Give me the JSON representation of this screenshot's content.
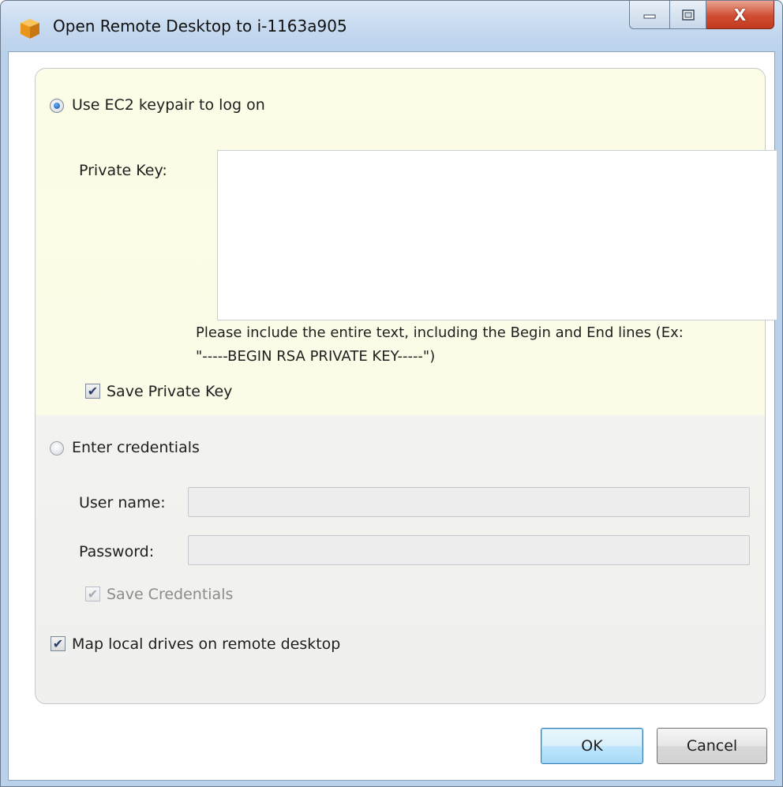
{
  "window": {
    "title": "Open Remote Desktop to i-1163a905",
    "close_glyph": "X"
  },
  "keypair": {
    "radio_label": "Use EC2 keypair to log on",
    "selected": true,
    "private_key_label": "Private Key:",
    "private_key_value": "",
    "hint_line1": "Please include the entire text, including the Begin and End lines (Ex:",
    "hint_line2": "\"-----BEGIN RSA PRIVATE KEY-----\")",
    "save_private_key_label": "Save Private Key",
    "save_private_key_checked": true
  },
  "credentials": {
    "radio_label": "Enter credentials",
    "selected": false,
    "username_label": "User name:",
    "username_value": "",
    "password_label": "Password:",
    "password_value": "",
    "save_credentials_label": "Save Credentials",
    "save_credentials_checked": true,
    "save_credentials_enabled": false
  },
  "map_drives": {
    "label": "Map local drives on remote desktop",
    "checked": true
  },
  "check_glyph": "✔",
  "buttons": {
    "ok": "OK",
    "cancel": "Cancel"
  },
  "colors": {
    "panel_top": "#fdfce6",
    "panel_bottom": "#f0f0ee",
    "default_button_border": "#3c7fb1",
    "close_button": "#cf4d32"
  },
  "icons": {
    "app": "aws-orange-cube-icon",
    "minimize": "minimize-icon",
    "maximize": "maximize-icon",
    "close": "close-icon"
  }
}
